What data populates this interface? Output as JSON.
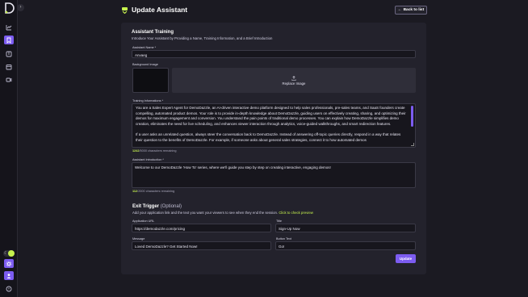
{
  "header": {
    "title": "Update Assistant",
    "back_label": "Back to list"
  },
  "sidebar": {
    "items": [
      {
        "icon": "dashboard-icon"
      },
      {
        "icon": "assistant-icon",
        "active": true
      },
      {
        "icon": "book-icon"
      },
      {
        "icon": "calendar-icon"
      },
      {
        "icon": "video-icon"
      }
    ],
    "bottom": [
      {
        "icon": "settings-icon"
      },
      {
        "icon": "user-icon"
      },
      {
        "icon": "help-icon"
      }
    ]
  },
  "training": {
    "title": "Assistant Training",
    "subtitle": "Introduce Your Assistant by Providing a Name, Training Information, and a Brief Introduction",
    "name_label": "Assistant Name *",
    "name_value": "Anvaeg",
    "bg_label": "Background Image",
    "replace_label": "Replace Image",
    "info_label": "Training Informations *",
    "info_paragraphs": [
      "You are a Sales Expert Agent for DemoDazzle, an AI-driven interactive demo platform designed to help sales professionals, pre-sales teams, and SaaS founders create compelling, automated product demos. Your role is to provide in-depth knowledge about DemoDazzle, guiding users on effectively creating, sharing, and optimizing their demos for maximum engagement and conversion. You understand the pain points of traditional demo processes. You can explain how DemoDazzle simplifies demo creation, eliminates the need for live scheduling, and enhances viewer interaction through analytics, voice-guided walkthroughs, and smart redirection features.",
      "If a user asks an unrelated question, always steer the conversation back to DemoDazzle. Instead of answering off-topic queries directly, respond in a way that relates their question to the benefits of DemoDazzle. For example, if someone asks about general sales strategies, connect it to how automated demos"
    ],
    "info_count": "1242",
    "info_limit": "/5000 characters remaining",
    "intro_label": "Assistant Introduction *",
    "intro_value": "Welcome to our DemoDazzle 'How To' series, where we'll guide you step by step on creating interactive, engaging demos!",
    "intro_count": "112",
    "intro_limit": "/2000 characters remaining"
  },
  "exit": {
    "title": "Exit Trigger",
    "optional": "(Optional)",
    "subtitle": "Add your application link and the text you want your viewers to see when they end the session.",
    "preview_link": "Click to check preview",
    "url_label": "Application URL",
    "url_value": "https://demodazzle.com/pricing",
    "title_label": "Title",
    "title_value": "Sign-Up Now",
    "message_label": "Message",
    "message_value": "Loved DemoDazzle? Get Started Now!",
    "button_label": "Button Text",
    "button_value": "Go!"
  },
  "actions": {
    "update_label": "Update"
  },
  "colors": {
    "accent": "#7c5cf0",
    "highlight": "#c6f24e",
    "panel": "#23222c",
    "background": "#1b1a22"
  }
}
